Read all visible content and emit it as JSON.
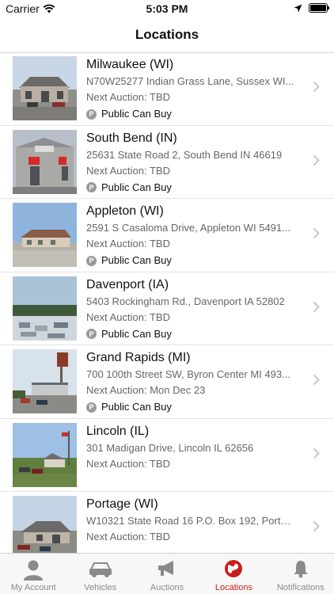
{
  "status_bar": {
    "carrier": "Carrier",
    "time": "5:03 PM"
  },
  "nav": {
    "title": "Locations"
  },
  "locations": [
    {
      "name": "Milwaukee (WI)",
      "address": "N70W25277 Indian Grass Lane, Sussex WI...",
      "next_auction": "Next Auction: TBD",
      "public_label": "Public Can Buy",
      "badge": "P"
    },
    {
      "name": "South Bend (IN)",
      "address": "25631 State Road 2, South Bend IN 46619",
      "next_auction": "Next Auction: TBD",
      "public_label": "Public Can Buy",
      "badge": "P"
    },
    {
      "name": "Appleton (WI)",
      "address": "2591 S Casaloma Drive, Appleton WI 5491...",
      "next_auction": "Next Auction: TBD",
      "public_label": "Public Can Buy",
      "badge": "P"
    },
    {
      "name": "Davenport (IA)",
      "address": "5403 Rockingham Rd., Davenport IA 52802",
      "next_auction": "Next Auction: TBD",
      "public_label": "Public Can Buy",
      "badge": "P"
    },
    {
      "name": "Grand Rapids (MI)",
      "address": "700 100th Street SW, Byron Center MI 493...",
      "next_auction": "Next Auction: Mon Dec 23",
      "public_label": "Public Can Buy",
      "badge": "P"
    },
    {
      "name": "Lincoln (IL)",
      "address": "301 Madigan Drive, Lincoln IL 62656",
      "next_auction": "Next Auction: TBD"
    },
    {
      "name": "Portage (WI)",
      "address": "W10321 State Road 16 P.O. Box 192, Porta...",
      "next_auction": "Next Auction: TBD"
    }
  ],
  "tabs": [
    {
      "label": "My Account",
      "icon": "person-icon"
    },
    {
      "label": "Vehicles",
      "icon": "car-icon"
    },
    {
      "label": "Auctions",
      "icon": "megaphone-icon"
    },
    {
      "label": "Locations",
      "icon": "globe-icon",
      "active": true
    },
    {
      "label": "Notifications",
      "icon": "bell-icon"
    }
  ],
  "colors": {
    "accent": "#c81e1e",
    "inactive_tab": "#8a8a8a",
    "secondary_text": "#666666"
  }
}
